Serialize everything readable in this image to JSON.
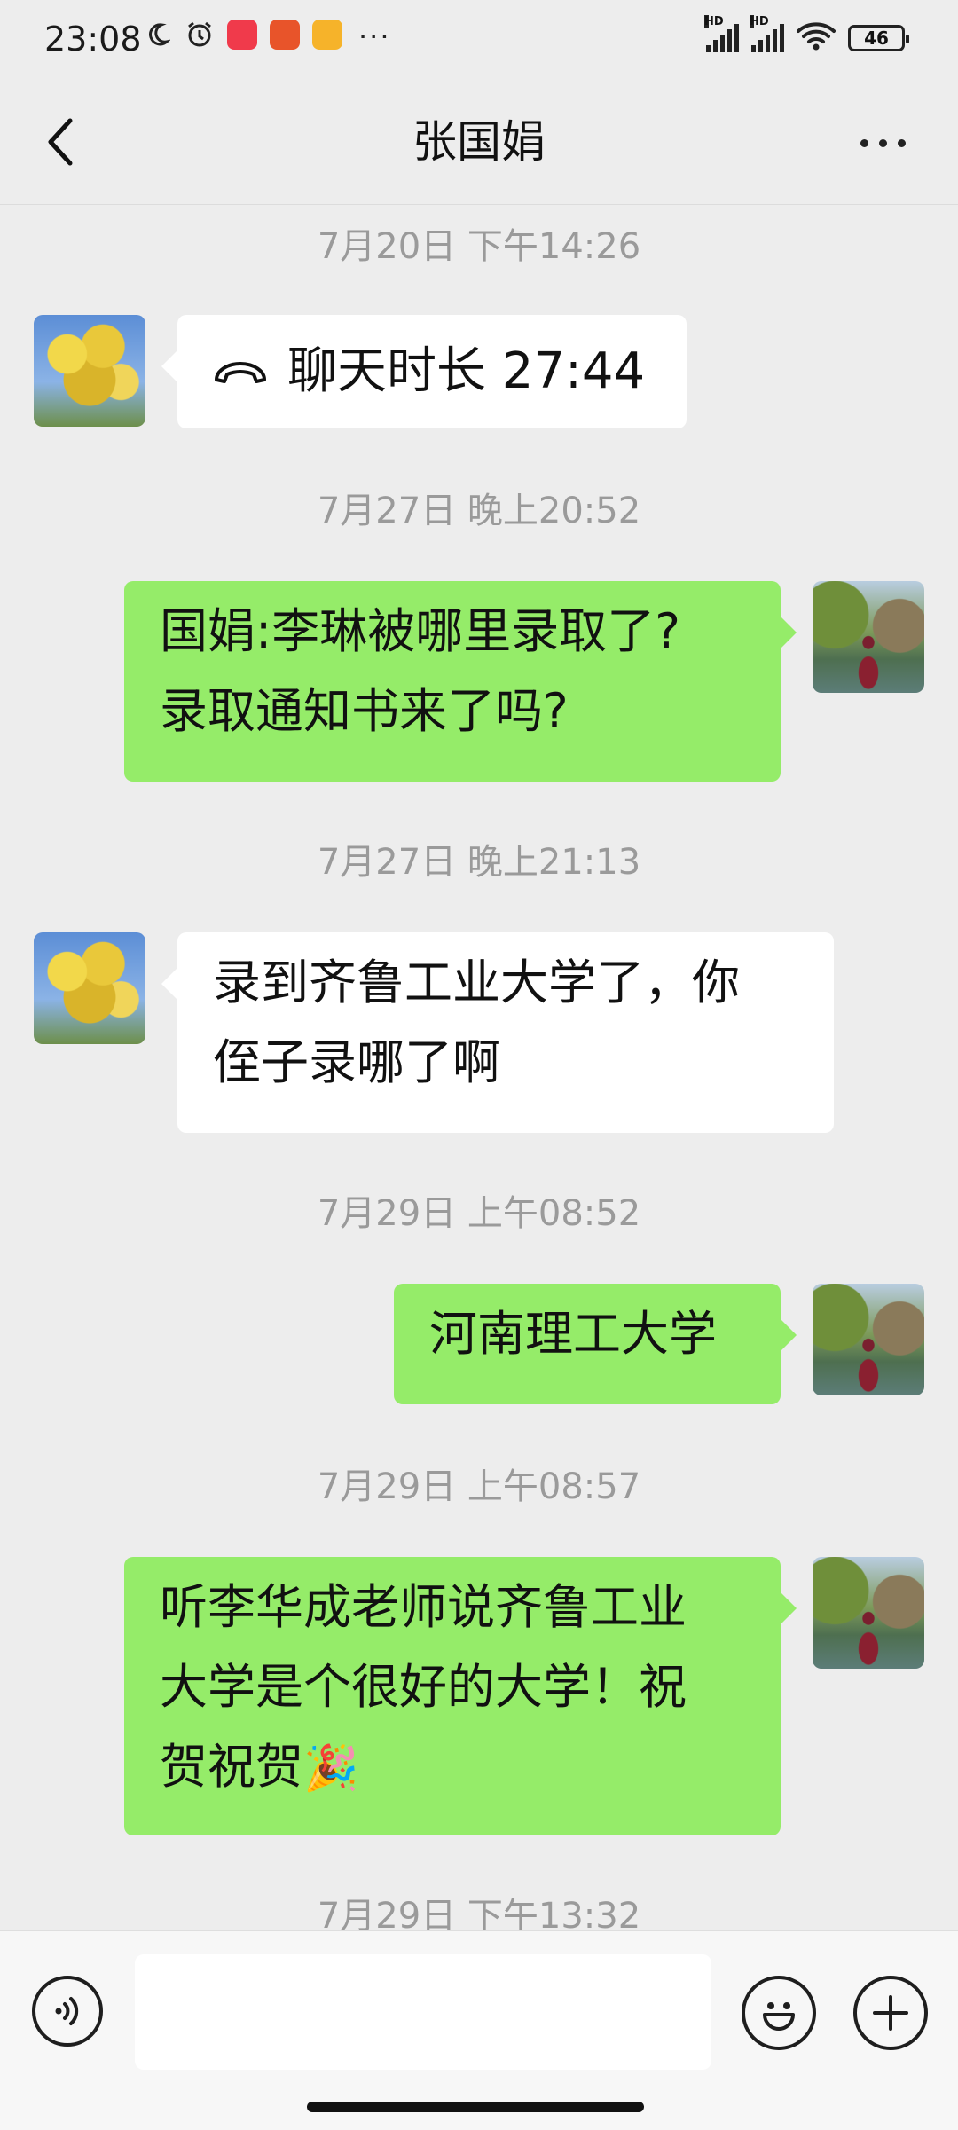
{
  "status_bar": {
    "time": "23:08",
    "dots": "···",
    "battery": "46",
    "hd1": "HD",
    "hd2": "HD"
  },
  "header": {
    "title": "张国娟"
  },
  "messages": [
    {
      "type": "timestamp",
      "text": "7月20日 下午14:26"
    },
    {
      "type": "call",
      "direction": "in",
      "label": "聊天时长 27:44"
    },
    {
      "type": "timestamp",
      "text": "7月27日 晚上20:52"
    },
    {
      "type": "text",
      "direction": "out",
      "lines": [
        "国娟:李琳被哪里录取了?",
        "录取通知书来了吗?"
      ]
    },
    {
      "type": "timestamp",
      "text": "7月27日 晚上21:13"
    },
    {
      "type": "text",
      "direction": "in",
      "lines": [
        "录到齐鲁工业大学了，你",
        "侄子录哪了啊"
      ]
    },
    {
      "type": "timestamp",
      "text": "7月29日 上午08:52"
    },
    {
      "type": "text",
      "direction": "out",
      "lines": [
        "河南理工大学"
      ]
    },
    {
      "type": "timestamp",
      "text": "7月29日 上午08:57"
    },
    {
      "type": "text",
      "direction": "out",
      "lines": [
        "听李华成老师说齐鲁工业",
        "大学是个很好的大学！祝",
        "贺祝贺"
      ],
      "emoji": "🎉"
    },
    {
      "type": "timestamp",
      "text": "7月29日 下午13:32"
    }
  ],
  "input": {
    "placeholder": ""
  },
  "icons": {
    "back": "back-arrow-icon",
    "more": "more-dots-icon",
    "voice": "voice-icon",
    "emoji": "emoji-icon",
    "plus": "plus-icon",
    "call": "phone-call-icon"
  }
}
